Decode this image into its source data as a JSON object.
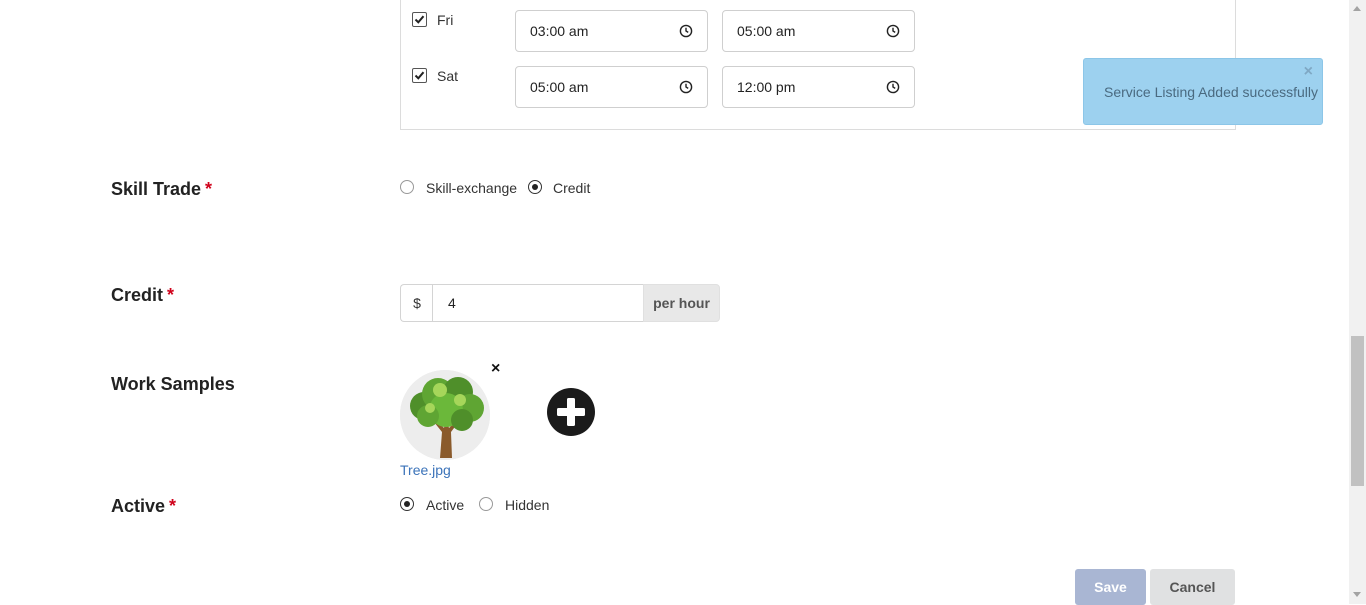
{
  "availability": {
    "rows": [
      {
        "day": "Fri",
        "checked": true,
        "start": "03:00 am",
        "end": "05:00 am"
      },
      {
        "day": "Sat",
        "checked": true,
        "start": "05:00 am",
        "end": "12:00 pm"
      }
    ]
  },
  "toast": {
    "message": "Service Listing Added successfully",
    "close": "×"
  },
  "skill_trade": {
    "label": "Skill Trade",
    "required": "*",
    "options": [
      {
        "label": "Skill-exchange",
        "selected": false
      },
      {
        "label": "Credit",
        "selected": true
      }
    ]
  },
  "credit": {
    "label": "Credit",
    "required": "*",
    "currency": "$",
    "value": "4",
    "unit": "per hour"
  },
  "work_samples": {
    "label": "Work Samples",
    "file_name": "Tree.jpg",
    "remove": "×"
  },
  "active": {
    "label": "Active",
    "required": "*",
    "options": [
      {
        "label": "Active",
        "selected": true
      },
      {
        "label": "Hidden",
        "selected": false
      }
    ]
  },
  "buttons": {
    "save": "Save",
    "cancel": "Cancel"
  },
  "colors": {
    "toast_bg": "#9dd1ef",
    "link": "#3b73b9",
    "required": "#d0021b",
    "save_bg": "#a9b6d3"
  }
}
